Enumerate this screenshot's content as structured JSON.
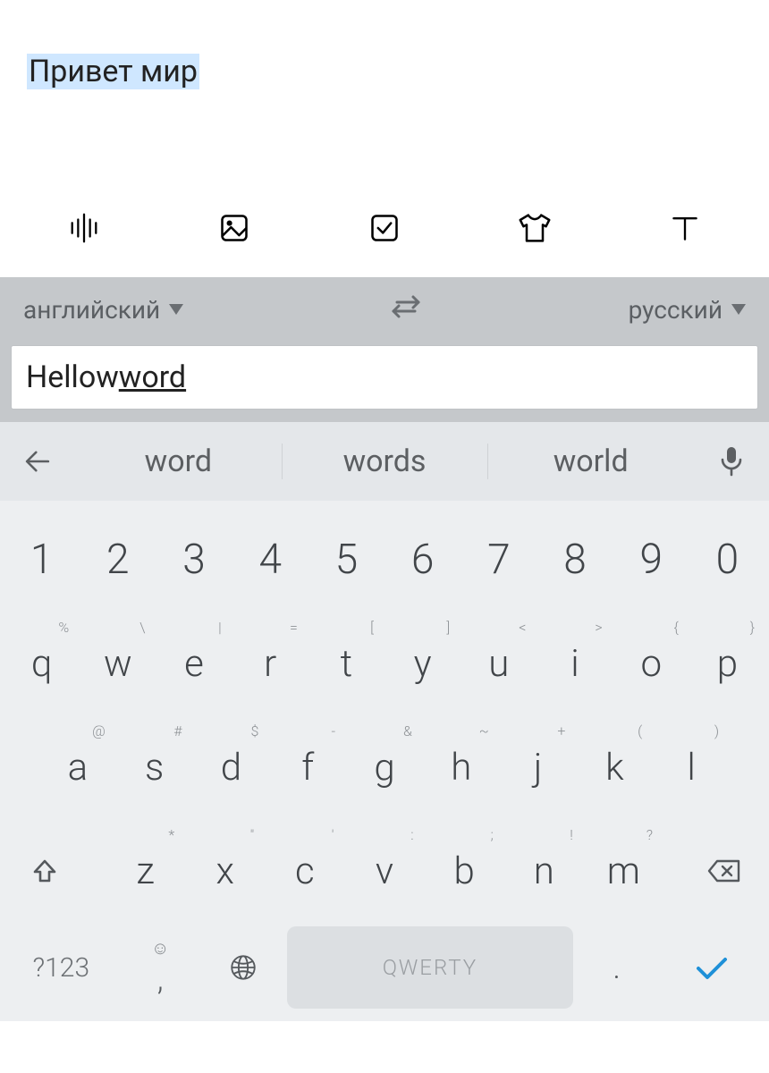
{
  "note": {
    "translated": "Привет мир"
  },
  "translate": {
    "source_lang": "английский",
    "target_lang": "русский",
    "input_plain": "Hellow ",
    "input_underlined": "word"
  },
  "suggestions": [
    "word",
    "words",
    "world"
  ],
  "keyboard": {
    "row_numbers": [
      "1",
      "2",
      "3",
      "4",
      "5",
      "6",
      "7",
      "8",
      "9",
      "0"
    ],
    "row_qwerty": [
      {
        "k": "q",
        "s": "%"
      },
      {
        "k": "w",
        "s": "\\"
      },
      {
        "k": "e",
        "s": "|"
      },
      {
        "k": "r",
        "s": "="
      },
      {
        "k": "t",
        "s": "["
      },
      {
        "k": "y",
        "s": "]"
      },
      {
        "k": "u",
        "s": "<"
      },
      {
        "k": "i",
        "s": ">"
      },
      {
        "k": "o",
        "s": "{"
      },
      {
        "k": "p",
        "s": "}"
      }
    ],
    "row_asdf": [
      {
        "k": "a",
        "s": "@"
      },
      {
        "k": "s",
        "s": "#"
      },
      {
        "k": "d",
        "s": "$"
      },
      {
        "k": "f",
        "s": "-"
      },
      {
        "k": "g",
        "s": "&"
      },
      {
        "k": "h",
        "s": "~"
      },
      {
        "k": "j",
        "s": "+"
      },
      {
        "k": "k",
        "s": "("
      },
      {
        "k": "l",
        "s": ")"
      }
    ],
    "row_zxcv": [
      {
        "k": "z",
        "s": "*"
      },
      {
        "k": "x",
        "s": "\""
      },
      {
        "k": "c",
        "s": "'"
      },
      {
        "k": "v",
        "s": ":"
      },
      {
        "k": "b",
        "s": ";"
      },
      {
        "k": "n",
        "s": "!"
      },
      {
        "k": "m",
        "s": "?"
      }
    ],
    "sym_label": "?123",
    "space_label": "QWERTY",
    "period": ".",
    "comma": ","
  }
}
